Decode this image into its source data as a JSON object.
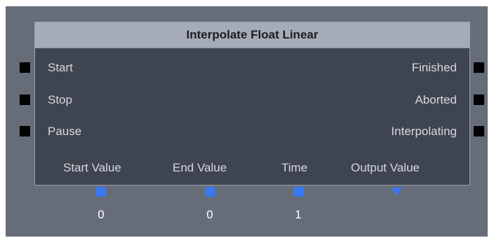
{
  "node": {
    "title": "Interpolate Float Linear",
    "flow_inputs": [
      {
        "label": "Start"
      },
      {
        "label": "Stop"
      },
      {
        "label": "Pause"
      }
    ],
    "flow_outputs": [
      {
        "label": "Finished"
      },
      {
        "label": "Aborted"
      },
      {
        "label": "Interpolating"
      }
    ],
    "variable_inputs": [
      {
        "label": "Start Value",
        "value": "0"
      },
      {
        "label": "End Value",
        "value": "0"
      },
      {
        "label": "Time",
        "value": "1"
      }
    ],
    "variable_outputs": [
      {
        "label": "Output Value"
      }
    ]
  },
  "colors": {
    "canvas_bg": "#666d79",
    "node_body": "#3e4450",
    "title_bar": "#a6acb7",
    "flow_pin": "#000000",
    "variable_pin": "#3a78f2"
  }
}
